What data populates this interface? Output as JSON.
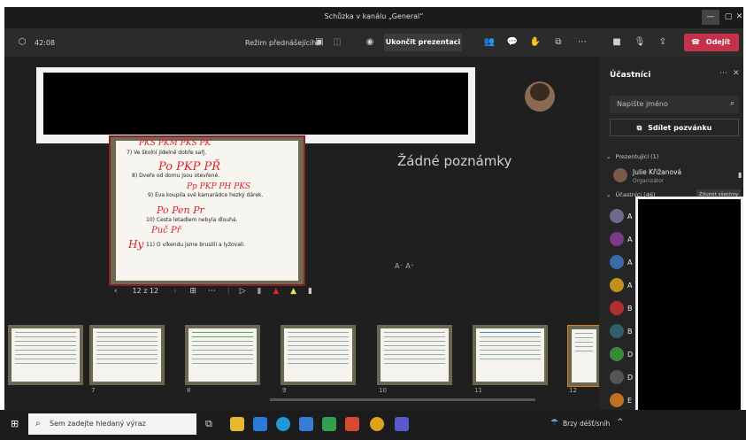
{
  "window": {
    "title": "Schůzka v kanálu „General“"
  },
  "toolbar": {
    "timer": "42:08",
    "presenter_mode_label": "Režim přednášejícího",
    "end_presentation_label": "Ukončit prezentaci",
    "leave_label": "Odejít"
  },
  "slide": {
    "lines": [
      "7) Ve školní jídelně dobře sařj.",
      "8) Dveře od domu jsou otevřené.",
      "9) Eva koupila své kamarádce hezký dárek.",
      "10) Cesta letadlem nebyla dlouhá.",
      "11) O víkendu jsme bruslili a lyžovali."
    ],
    "ink": [
      "PKS  PKM  PKS  PK",
      "Po  PKP  PŘ",
      "Pp  PKP  PH  PKS",
      "Po  Pen  Pr",
      "Puč      Př",
      "Hy"
    ]
  },
  "notes": {
    "empty_label": "Žádné poznámky",
    "font_controls": "A⁻  A⁺"
  },
  "slidenav": {
    "counter": "12 z 12"
  },
  "filmstrip": {
    "page_numbers": [
      "7",
      "8",
      "9",
      "10",
      "11",
      "12"
    ]
  },
  "participants": {
    "title": "Účastníci",
    "search_placeholder": "Napište jméno",
    "share_invite_label": "Sdílet pozvánku",
    "presenters_header": "Prezentující (1)",
    "presenter": {
      "name": "Julie Křižanová",
      "role": "Organizátor"
    },
    "attendees_header": "Účastníci (46)",
    "mute_all_label": "Ztlumit všechny",
    "attendee_initials": [
      "A",
      "A",
      "A",
      "A",
      "B",
      "B",
      "D",
      "D",
      "E"
    ]
  },
  "taskbar": {
    "search_placeholder": "Sem zadejte hledaný výraz",
    "weather": "Brzy déšť/sníh"
  }
}
